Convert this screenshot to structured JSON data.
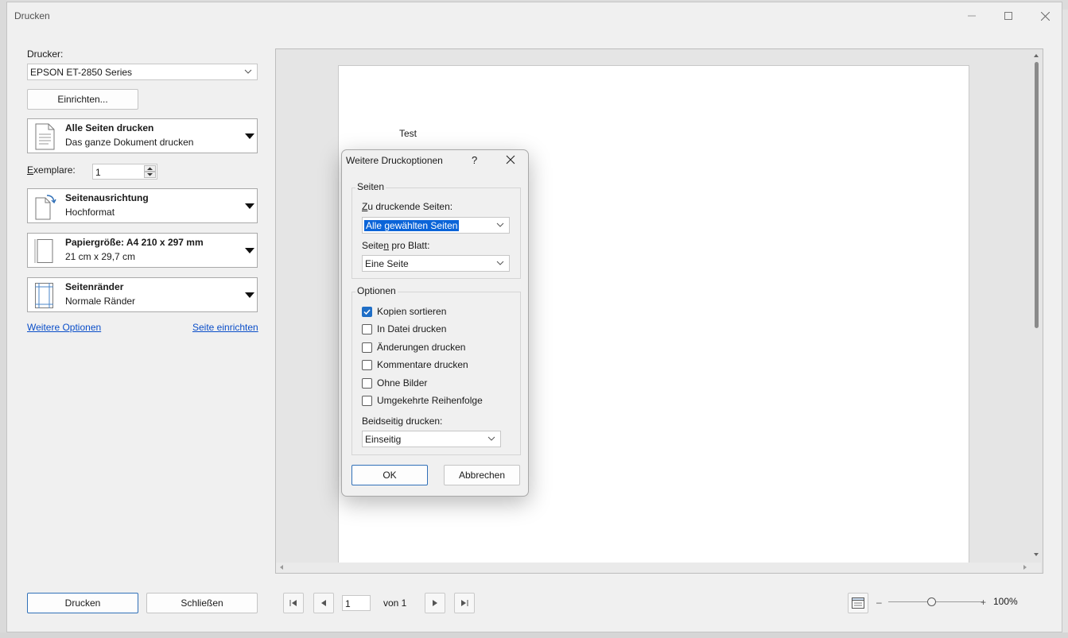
{
  "window": {
    "title": "Drucken"
  },
  "printer": {
    "label": "Drucker:",
    "selected": "EPSON ET-2850 Series",
    "setup_button": "Einrichten..."
  },
  "settings": [
    {
      "title": "Alle Seiten drucken",
      "subtitle": "Das ganze Dokument drucken",
      "icon": "document-pages-icon"
    },
    {
      "title": "Seitenausrichtung",
      "subtitle": "Hochformat",
      "icon": "orientation-icon"
    },
    {
      "title": "Papiergröße: A4 210 x 297 mm",
      "subtitle": "21 cm x 29,7 cm",
      "icon": "paper-size-icon"
    },
    {
      "title": "Seitenränder",
      "subtitle": "Normale Ränder",
      "icon": "margins-icon"
    }
  ],
  "copies": {
    "label": "Exemplare:",
    "value": "1"
  },
  "links": {
    "more_options": "Weitere Optionen",
    "page_setup": "Seite einrichten"
  },
  "preview": {
    "page_text": "Test"
  },
  "footer": {
    "print_button": "Drucken",
    "close_button": "Schließen",
    "page_value": "1",
    "page_of": "von 1",
    "zoom": "100%",
    "zoom_minus": "–",
    "zoom_plus": "+"
  },
  "dialog": {
    "title": "Weitere Druckoptionen",
    "help": "?",
    "pages_group": "Seiten",
    "pages_to_print_label": "Zu druckende Seiten:",
    "pages_to_print_value": "Alle gewählten Seiten",
    "pages_per_sheet_label": "Seiten pro Blatt:",
    "pages_per_sheet_value": "Eine Seite",
    "options_group": "Optionen",
    "options": [
      {
        "label": "Kopien sortieren",
        "checked": true
      },
      {
        "label": "In Datei drucken",
        "checked": false
      },
      {
        "label": "Änderungen drucken",
        "checked": false
      },
      {
        "label": "Kommentare drucken",
        "checked": false
      },
      {
        "label": "Ohne Bilder",
        "checked": false
      },
      {
        "label": "Umgekehrte Reihenfolge",
        "checked": false
      }
    ],
    "duplex_label": "Beidseitig drucken:",
    "duplex_value": "Einseitig",
    "ok_button": "OK",
    "cancel_button": "Abbrechen"
  },
  "colors": {
    "accent": "#0a64d8",
    "link": "#0a4ec9",
    "checkbox": "#1f6ec6"
  }
}
